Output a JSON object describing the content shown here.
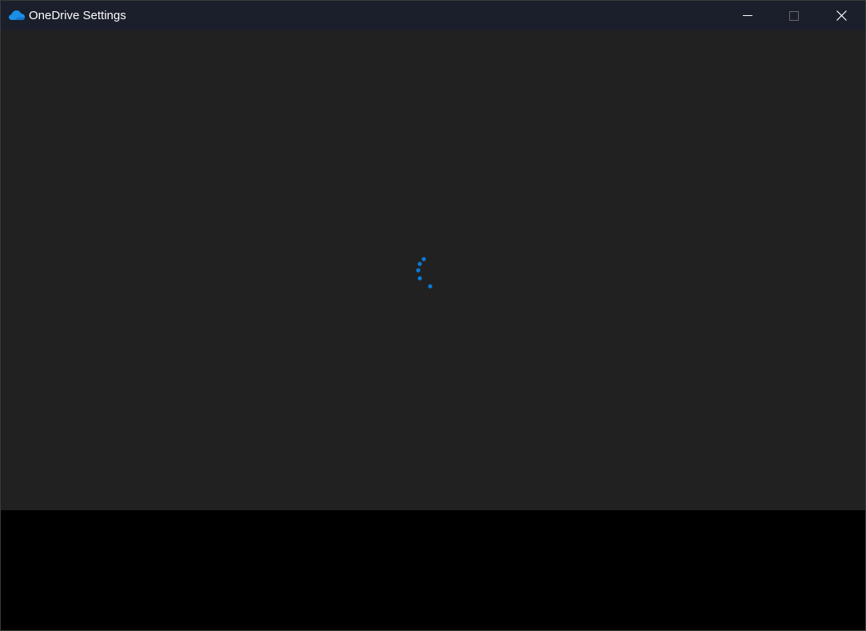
{
  "window": {
    "title": "OneDrive Settings",
    "app_icon": "onedrive-cloud-icon",
    "controls": {
      "minimize_icon": "minimize-icon",
      "maximize_icon": "maximize-icon",
      "close_icon": "close-icon"
    }
  },
  "content": {
    "state": "loading",
    "spinner_icon": "loading-spinner-icon"
  },
  "colors": {
    "titlebar_bg": "#1b1e2b",
    "content_bg": "#212121",
    "accent": "#0a7ad6",
    "onedrive_blue": "#1c8ee6",
    "text": "#ffffff"
  }
}
